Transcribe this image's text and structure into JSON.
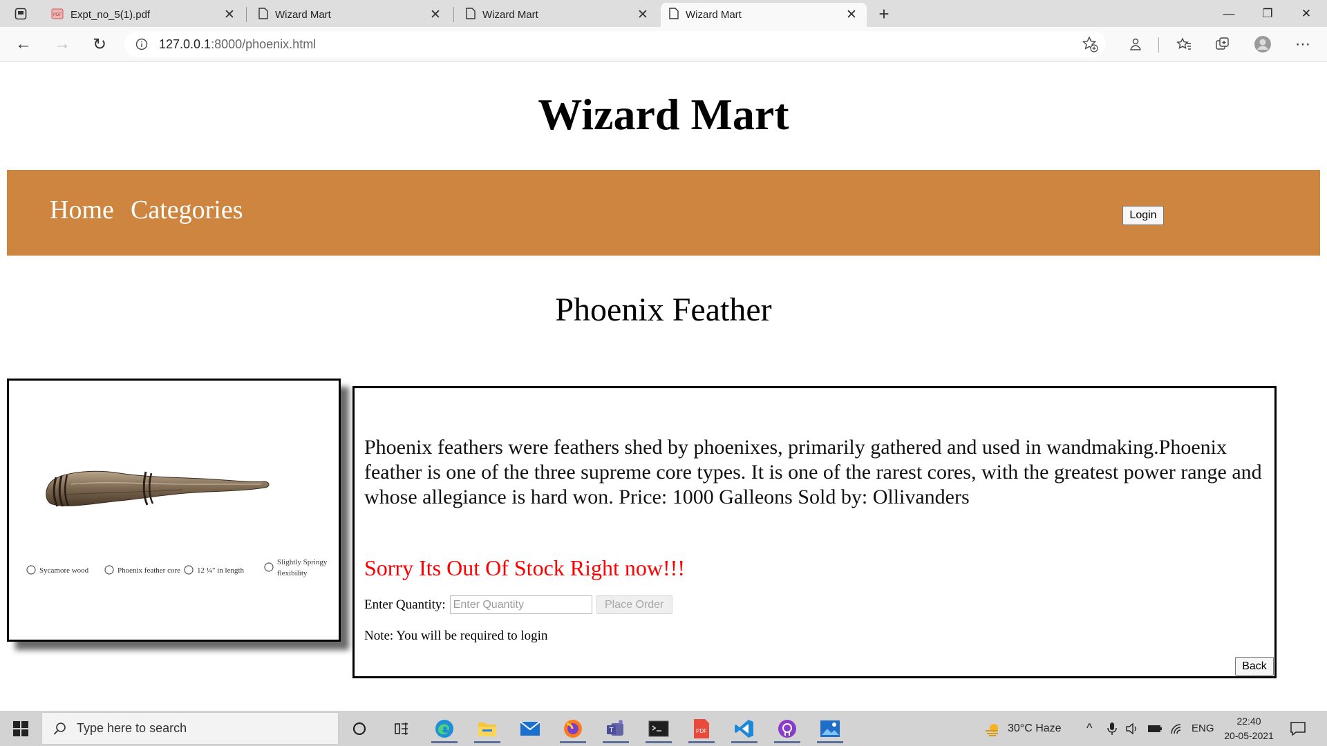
{
  "browser": {
    "tabs": [
      {
        "label": "Expt_no_5(1).pdf",
        "icon": "pdf-icon"
      },
      {
        "label": "Wizard Mart",
        "icon": "page-icon"
      },
      {
        "label": "Wizard Mart",
        "icon": "page-icon"
      },
      {
        "label": "Wizard Mart",
        "icon": "page-icon",
        "active": true
      }
    ],
    "url_host": "127.0.0.1",
    "url_rest": ":8000/phoenix.html"
  },
  "site": {
    "title": "Wizard Mart",
    "nav": {
      "home": "Home",
      "categories": "Categories",
      "login": "Login"
    },
    "accent_color": "#cd853f"
  },
  "product": {
    "title": "Phoenix Feather",
    "image_labels": [
      "Sycamore wood",
      "Phoenix feather core",
      "12 ¼\" in length",
      "Slightly Springy",
      "flexibility"
    ],
    "description": "Phoenix feathers were feathers shed by phoenixes, primarily gathered and used in wandmaking.Phoenix feather is one of the three supreme core types. It is one of the rarest cores, with the greatest power range and whose allegiance is hard won. Price: 1000 Galleons Sold by: Ollivanders",
    "stock_message": "Sorry Its Out Of Stock Right now!!!",
    "stock_color": "#ff0000",
    "quantity_label": "Enter Quantity:",
    "quantity_placeholder": "Enter Quantity",
    "order_button": "Place Order",
    "note": "Note: You will be required to login",
    "back_button": "Back"
  },
  "taskbar": {
    "search_placeholder": "Type here to search",
    "weather": "30°C  Haze",
    "language": "ENG",
    "time": "22:40",
    "date": "20-05-2021"
  }
}
